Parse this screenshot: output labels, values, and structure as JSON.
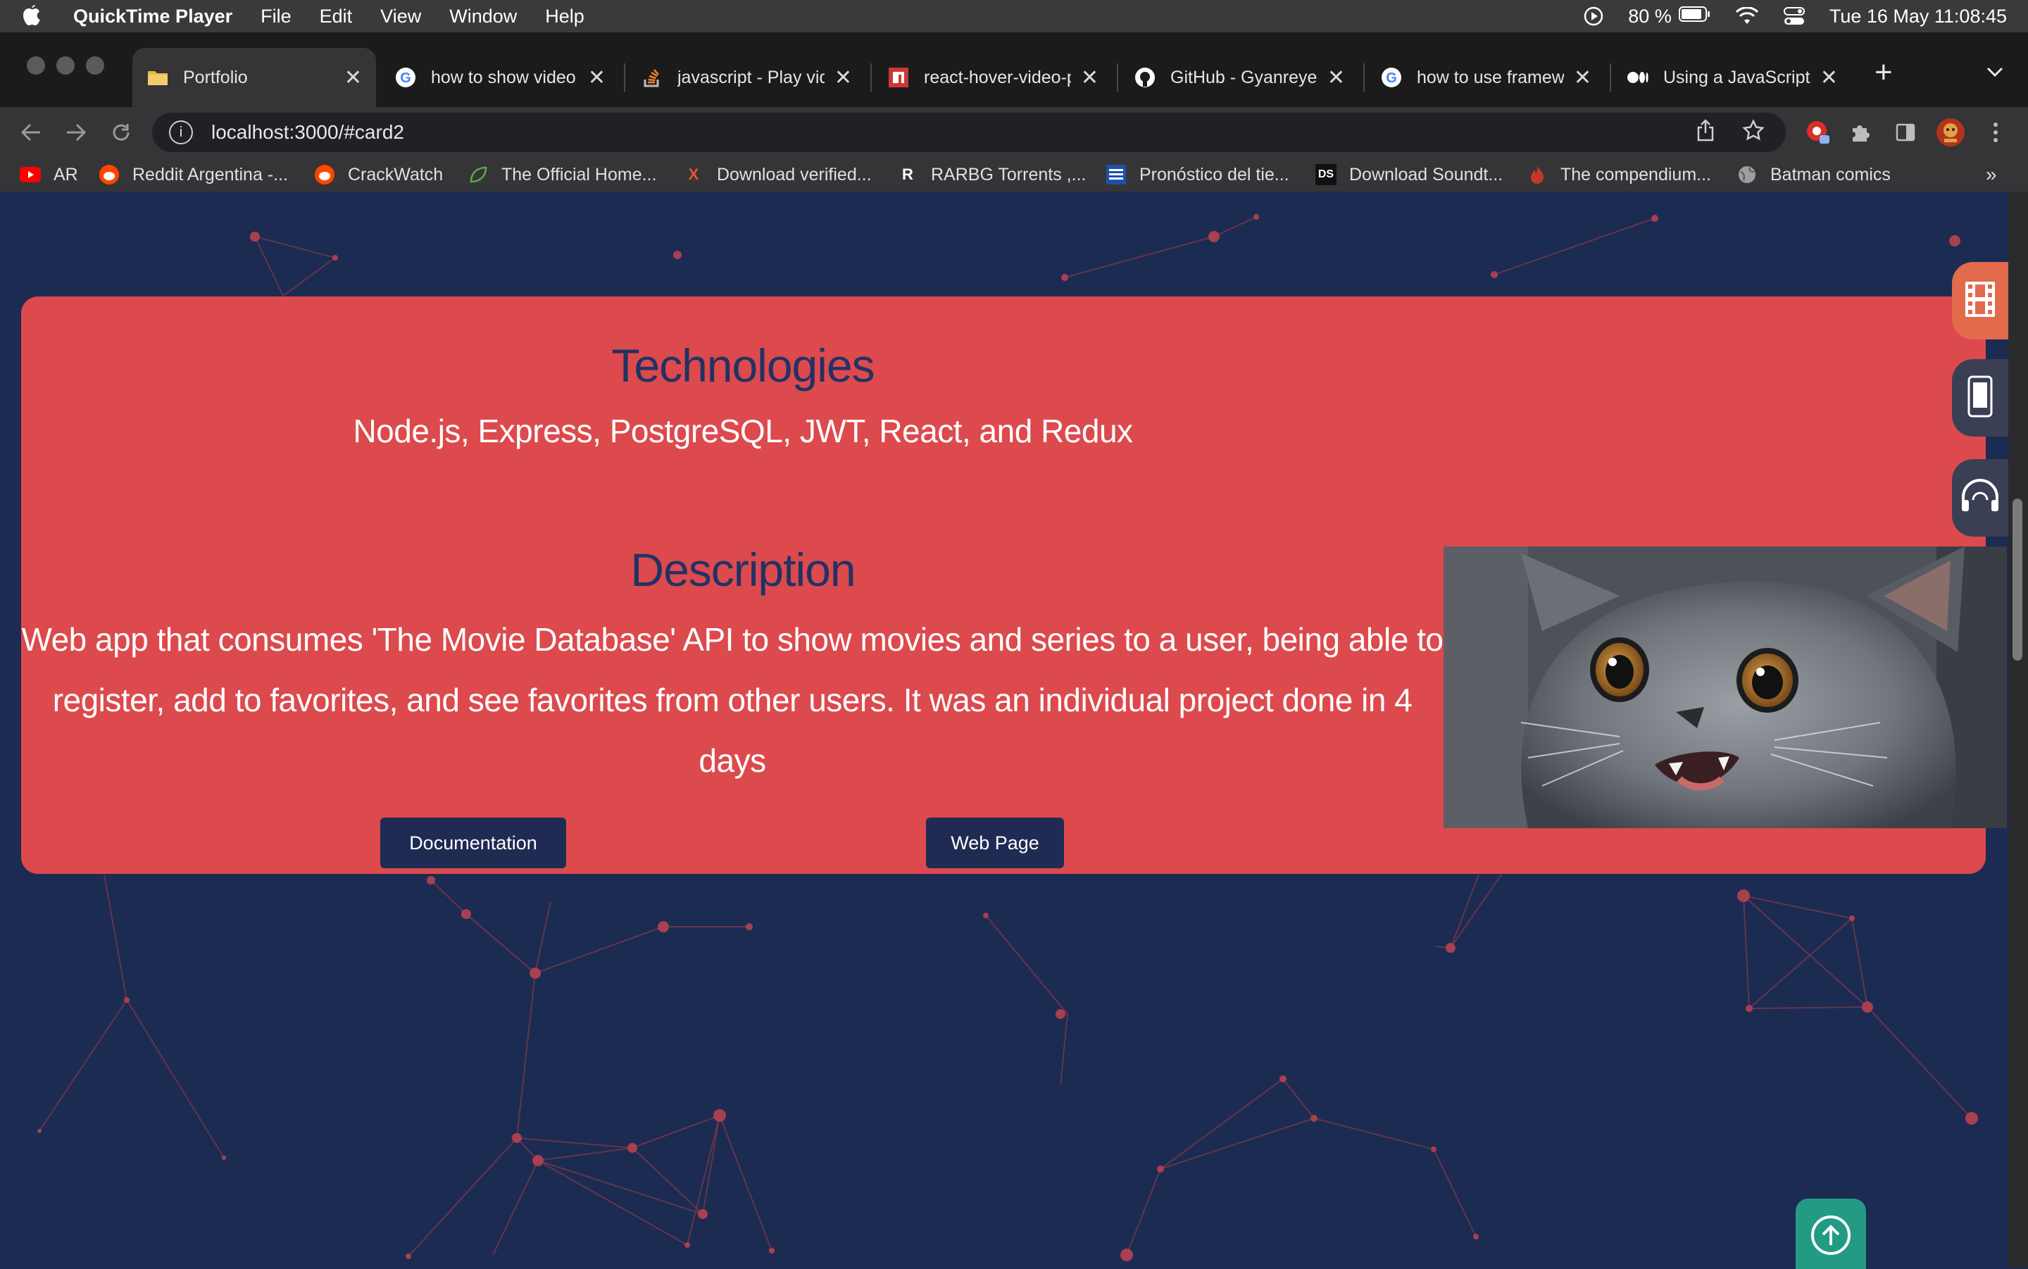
{
  "menubar": {
    "app": "QuickTime Player",
    "items": [
      "File",
      "Edit",
      "View",
      "Window",
      "Help"
    ],
    "battery": "80 %",
    "datetime": "Tue 16 May  11:08:45"
  },
  "tabs": [
    {
      "label": "Portfolio",
      "icon": "folder-icon"
    },
    {
      "label": "how to show video o",
      "icon": "google-icon"
    },
    {
      "label": "javascript - Play vid",
      "icon": "stackoverflow-icon"
    },
    {
      "label": "react-hover-video-p",
      "icon": "npm-icon"
    },
    {
      "label": "GitHub - Gyanreyer",
      "icon": "github-icon"
    },
    {
      "label": "how to use framew",
      "icon": "google-icon"
    },
    {
      "label": "Using a JavaScript",
      "icon": "medium-icon"
    }
  ],
  "address": {
    "url": "localhost:3000/#card2"
  },
  "bookmarks": [
    {
      "label": "AR",
      "icon": "youtube-icon"
    },
    {
      "label": "Reddit Argentina -...",
      "icon": "reddit-icon"
    },
    {
      "label": "CrackWatch",
      "icon": "reddit-icon"
    },
    {
      "label": "The Official Home...",
      "icon": "leaf-icon"
    },
    {
      "label": "Download verified...",
      "icon": "x-icon"
    },
    {
      "label": "RARBG Torrents ,...",
      "icon": "r-icon"
    },
    {
      "label": "Pronóstico del tie...",
      "icon": "weather-icon"
    },
    {
      "label": "Download Soundt...",
      "icon": "ds-icon"
    },
    {
      "label": "The compendium...",
      "icon": "flame-icon"
    },
    {
      "label": "Batman comics",
      "icon": "globe-icon"
    }
  ],
  "card": {
    "technologies_title": "Technologies",
    "technologies_text": "Node.js, Express, PostgreSQL, JWT, React, and Redux",
    "description_title": "Description",
    "description_text": "Web app that consumes 'The Movie Database' API to show movies and series to a user, being able to register, add to favorites, and see favorites from other users. It was an individual project done in 4 days",
    "buttons": {
      "documentation": "Documentation",
      "web_page": "Web Page"
    }
  },
  "colors": {
    "page_bg": "#1c2b52",
    "card_bg": "#dc4a4d",
    "heading": "#223264",
    "button_bg": "#1f2b52",
    "side_film": "#e26a4d",
    "side_other": "#3a3f54",
    "to_top": "#239b84"
  }
}
